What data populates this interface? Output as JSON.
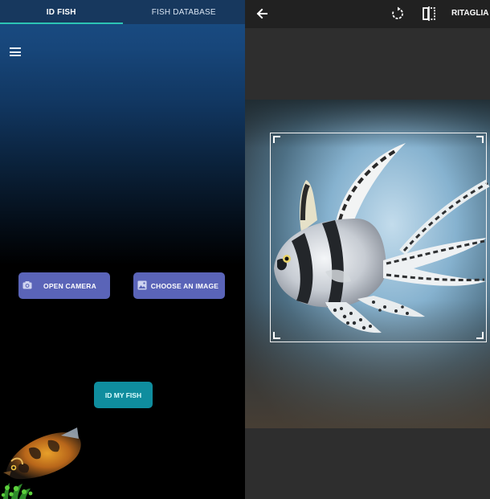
{
  "left": {
    "tabs": [
      {
        "label": "ID FISH",
        "active": true
      },
      {
        "label": "FISH DATABASE",
        "active": false
      }
    ],
    "buttons": {
      "open_camera": "OPEN CAMERA",
      "choose_image": "CHOOSE AN IMAGE",
      "id_my_fish": "ID MY FISH"
    },
    "colors": {
      "action_button": "#5a64b8",
      "id_button": "#0f8d9e",
      "tab_indicator": "#2cc4b4"
    }
  },
  "right": {
    "toolbar": {
      "back_icon": "arrow-left-icon",
      "rotate_icon": "rotate-icon",
      "flip_icon": "flip-icon",
      "crop_label": "RITAGLIA"
    }
  }
}
